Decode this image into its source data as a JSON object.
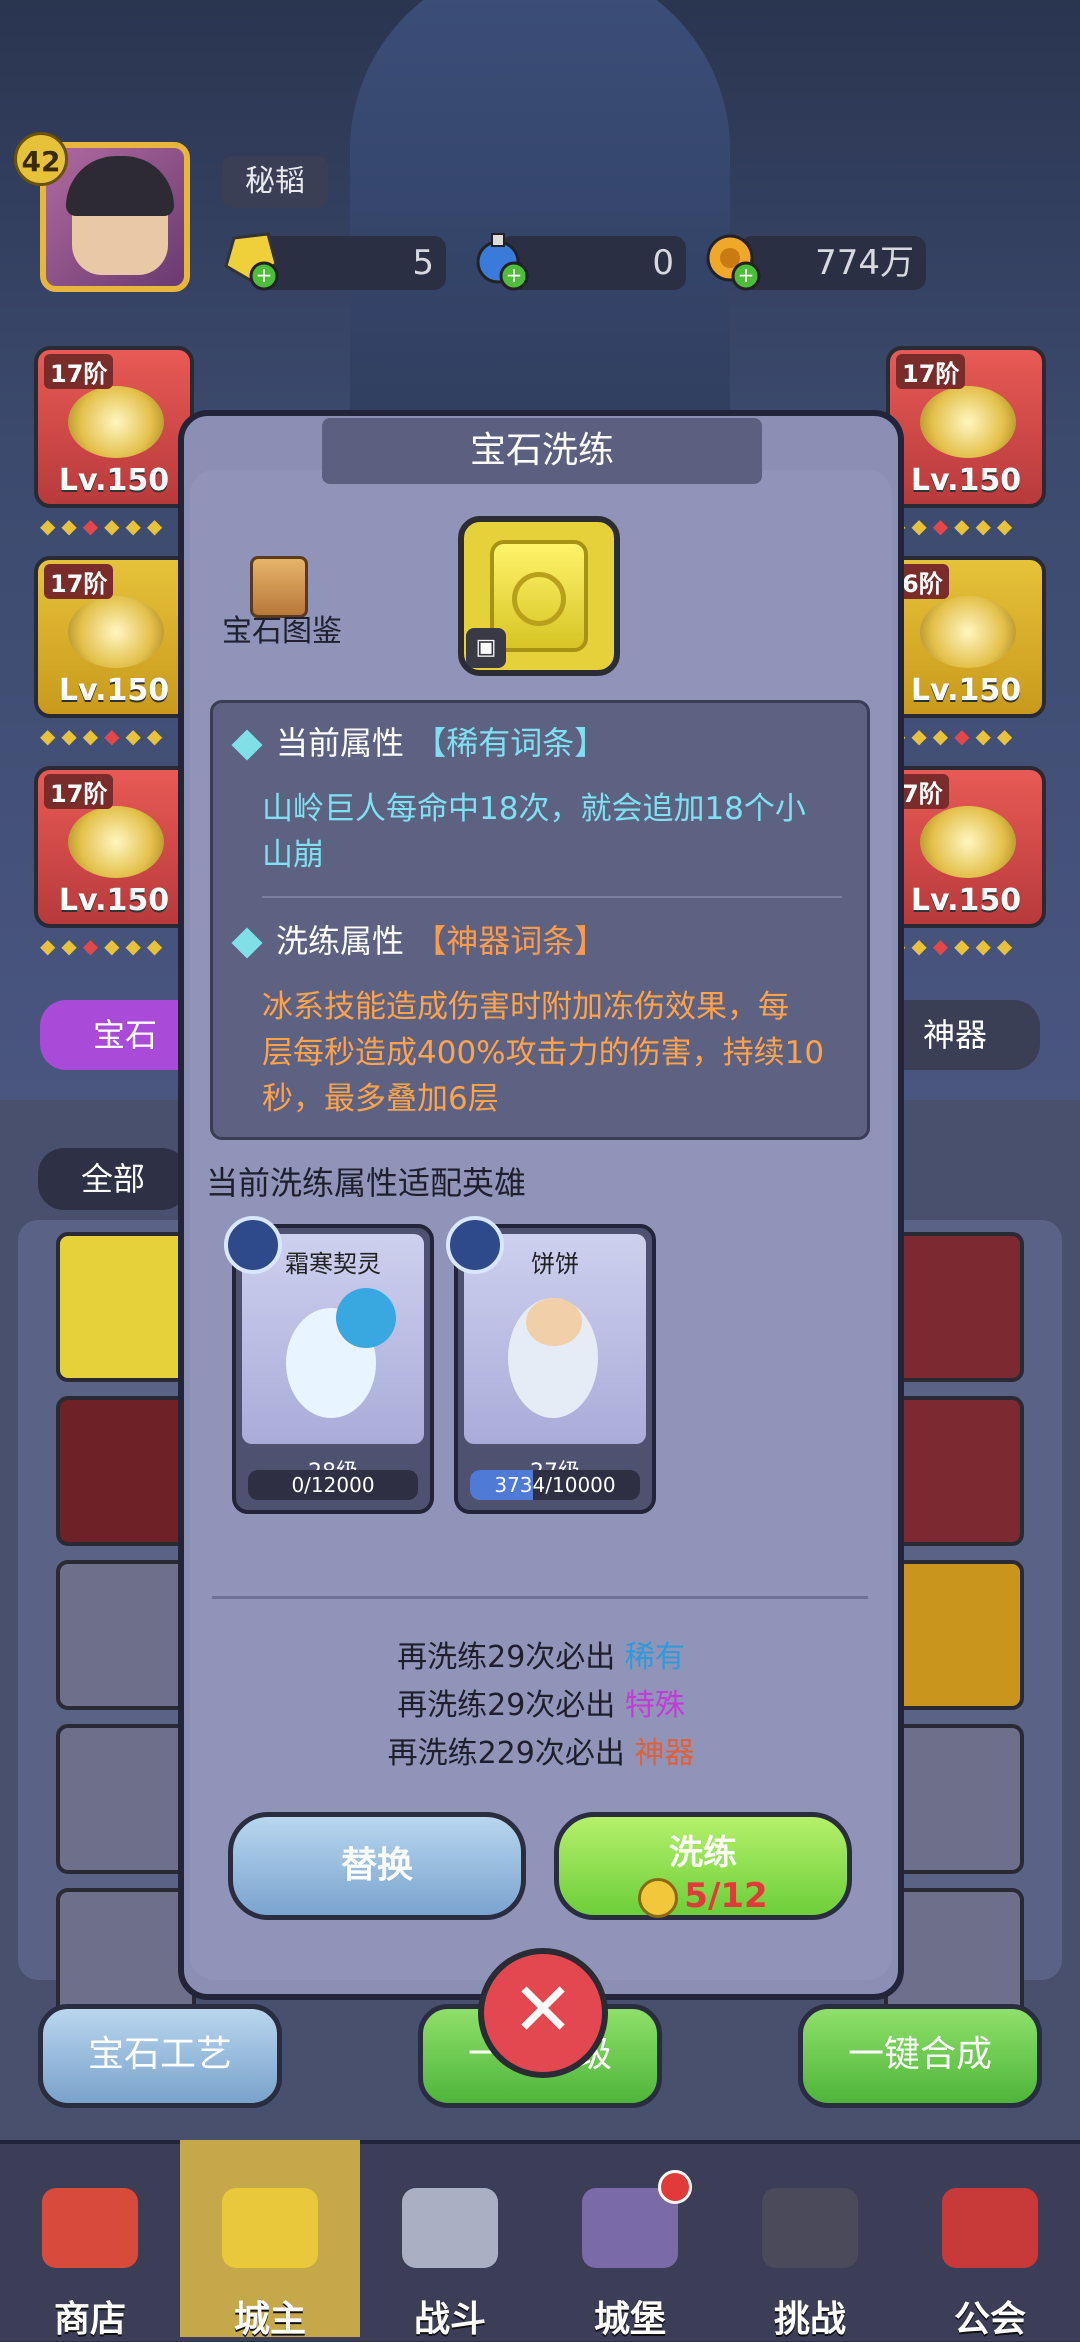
{
  "player": {
    "level": "42",
    "name": "秘韬"
  },
  "resources": [
    {
      "icon": "gold-gem-plus-icon",
      "value": "5"
    },
    {
      "icon": "blue-potion-plus-icon",
      "value": "0"
    },
    {
      "icon": "gold-coin-plus-icon",
      "value": "774万"
    }
  ],
  "equipment": {
    "left": [
      {
        "tier": "17阶",
        "level": "Lv.150"
      },
      {
        "tier": "17阶",
        "level": "Lv.150"
      },
      {
        "tier": "17阶",
        "level": "Lv.150"
      }
    ],
    "right": [
      {
        "tier": "17阶",
        "level": "Lv.150"
      },
      {
        "tier": "6阶",
        "level": "Lv.150"
      },
      {
        "tier": "7阶",
        "level": "Lv.150"
      }
    ]
  },
  "tabs": {
    "gem": "宝石",
    "artifact": "神器",
    "filter_all": "全部"
  },
  "modal": {
    "title": "宝石洗练",
    "gem_catalog": "宝石图鉴",
    "current": {
      "label": "当前属性",
      "tag": "【稀有词条】",
      "desc_line1": "山岭巨人每命中18次，就会追加18个小",
      "desc_line2": "山崩"
    },
    "refine": {
      "label": "洗练属性",
      "tag": "【神器词条】",
      "desc_line1": "冰系技能造成伤害时附加冻伤效果，每",
      "desc_line2": "层每秒造成400%攻击力的伤害，持续10",
      "desc_line3": "秒，最多叠加6层"
    },
    "heroes_caption": "当前洗练属性适配英雄",
    "heroes": [
      {
        "name": "霜寒契灵",
        "level": "28级",
        "exp": "0/12000",
        "progress": 0
      },
      {
        "name": "饼饼",
        "level": "27级",
        "exp": "3734/10000",
        "progress": 0.3734
      }
    ],
    "pity": [
      {
        "prefix": "再洗练29次必出",
        "rarity": "稀有",
        "color": "#2f9ad8"
      },
      {
        "prefix": "再洗练29次必出",
        "rarity": "特殊",
        "color": "#c43ad8"
      },
      {
        "prefix": "再洗练229次必出",
        "rarity": "神器",
        "color": "#e0603a"
      }
    ],
    "replace_button": "替换",
    "refine_button": "洗练",
    "refine_cost": "5/12",
    "cost_color": "#e23a3a"
  },
  "bottom_buttons": {
    "craft": "宝石工艺",
    "upgrade": "一键升级",
    "merge": "一键合成"
  },
  "nav": [
    {
      "label": "商店",
      "icon": "shop-icon"
    },
    {
      "label": "城主",
      "icon": "crown-icon"
    },
    {
      "label": "战斗",
      "icon": "crossed-swords-icon"
    },
    {
      "label": "城堡",
      "icon": "castle-icon"
    },
    {
      "label": "挑战",
      "icon": "demon-mask-icon"
    },
    {
      "label": "公会",
      "icon": "guild-banner-icon"
    }
  ]
}
